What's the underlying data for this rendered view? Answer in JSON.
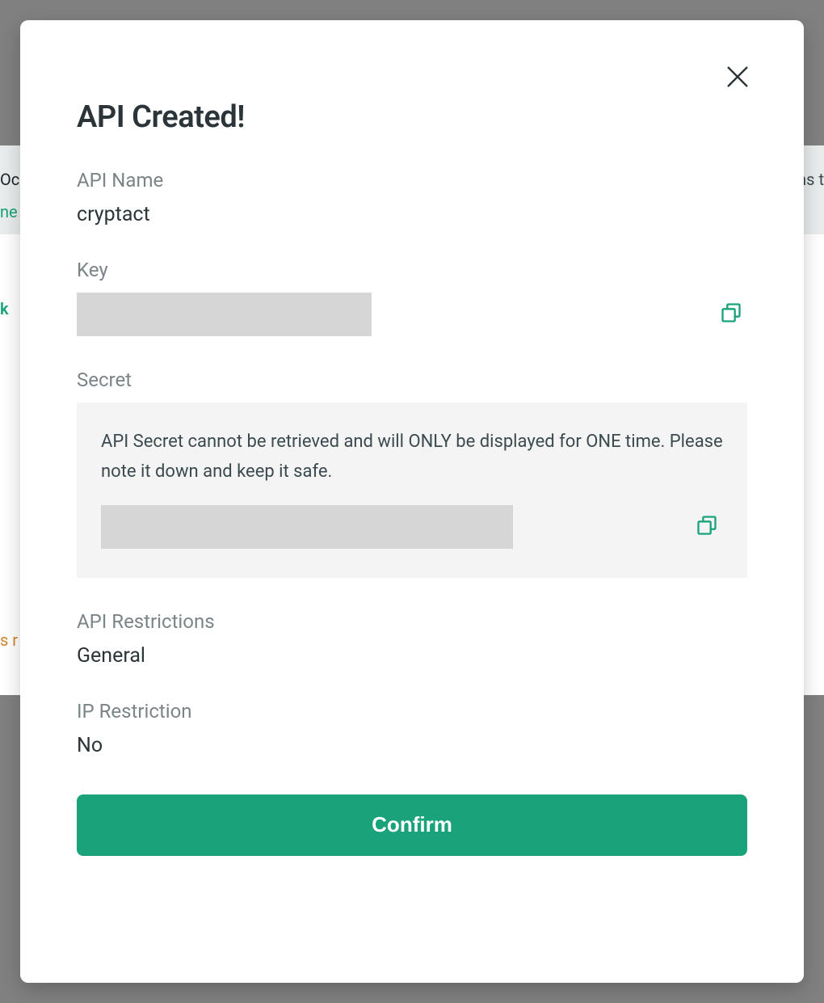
{
  "modal": {
    "title": "API Created!",
    "api_name_label": "API Name",
    "api_name_value": "cryptact",
    "key_label": "Key",
    "secret_label": "Secret",
    "secret_note": "API Secret cannot be retrieved and will ONLY be displayed for ONE time. Please note it down and keep it safe.",
    "restrictions_label": "API Restrictions",
    "restrictions_value": "General",
    "ip_restriction_label": "IP Restriction",
    "ip_restriction_value": "No",
    "confirm_label": "Confirm"
  },
  "colors": {
    "accent": "#1aa37a",
    "text_primary": "#2b3438",
    "text_muted": "#7b8488",
    "panel_bg": "#f4f4f4",
    "redact_bg": "#d6d6d6"
  }
}
